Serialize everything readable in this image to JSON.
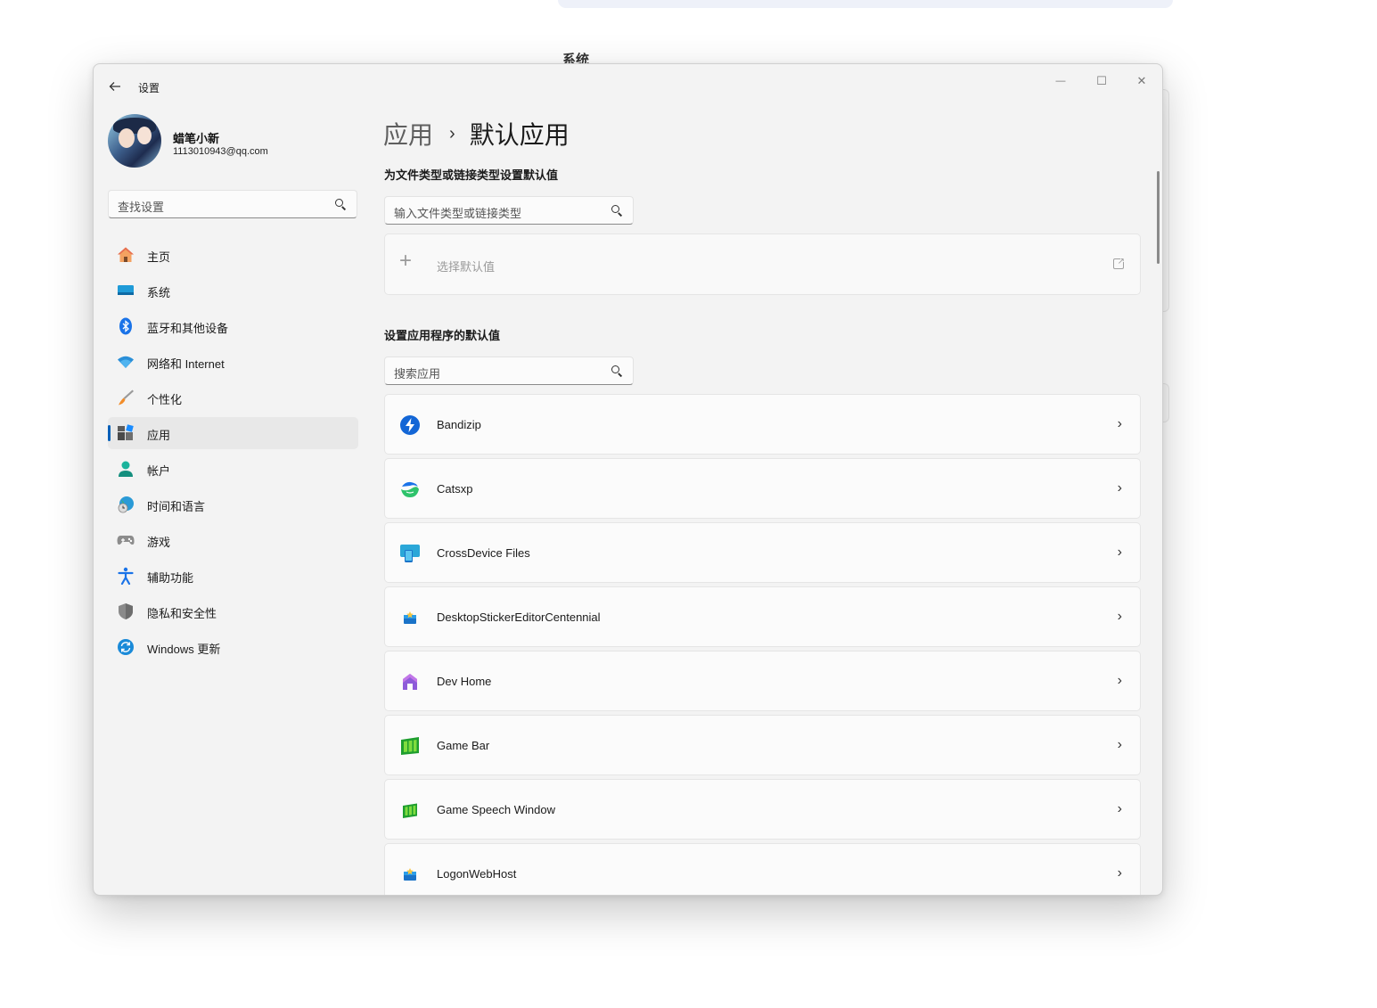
{
  "background": {
    "section_title": "系统"
  },
  "window": {
    "title": "设置",
    "controls": {
      "minimize": "—",
      "maximize": "☐",
      "close": "✕"
    }
  },
  "profile": {
    "name": "蜡笔小新",
    "email": "1113010943@qq.com"
  },
  "sidebar": {
    "search_placeholder": "查找设置",
    "items": [
      {
        "label": "主页",
        "icon": "home-icon",
        "selected": false
      },
      {
        "label": "系统",
        "icon": "system-icon",
        "selected": false
      },
      {
        "label": "蓝牙和其他设备",
        "icon": "bluetooth-icon",
        "selected": false
      },
      {
        "label": "网络和 Internet",
        "icon": "wifi-icon",
        "selected": false
      },
      {
        "label": "个性化",
        "icon": "brush-icon",
        "selected": false
      },
      {
        "label": "应用",
        "icon": "apps-icon",
        "selected": true
      },
      {
        "label": "帐户",
        "icon": "account-icon",
        "selected": false
      },
      {
        "label": "时间和语言",
        "icon": "globe-clock-icon",
        "selected": false
      },
      {
        "label": "游戏",
        "icon": "gamepad-icon",
        "selected": false
      },
      {
        "label": "辅助功能",
        "icon": "accessibility-icon",
        "selected": false
      },
      {
        "label": "隐私和安全性",
        "icon": "shield-icon",
        "selected": false
      },
      {
        "label": "Windows 更新",
        "icon": "update-icon",
        "selected": false
      }
    ]
  },
  "main": {
    "breadcrumb": {
      "parent": "应用",
      "separator": "›",
      "current": "默认应用"
    },
    "file_type_section": {
      "heading": "为文件类型或链接类型设置默认值",
      "search_placeholder": "输入文件类型或链接类型",
      "choose_default_label": "选择默认值"
    },
    "apps_section": {
      "heading": "设置应用程序的默认值",
      "search_placeholder": "搜索应用",
      "apps": [
        {
          "name": "Bandizip",
          "icon": "bandizip-icon"
        },
        {
          "name": "Catsxp",
          "icon": "catsxp-icon"
        },
        {
          "name": "CrossDevice Files",
          "icon": "crossdevice-icon"
        },
        {
          "name": "DesktopStickerEditorCentennial",
          "icon": "sticker-editor-icon"
        },
        {
          "name": "Dev Home",
          "icon": "dev-home-icon"
        },
        {
          "name": "Game Bar",
          "icon": "game-bar-icon"
        },
        {
          "name": "Game Speech Window",
          "icon": "game-speech-icon"
        },
        {
          "name": "LogonWebHost",
          "icon": "logon-webhost-icon"
        }
      ]
    }
  },
  "colors": {
    "accent": "#005fb8",
    "window_bg": "#f3f3f3",
    "card_bg": "#fbfbfb"
  }
}
